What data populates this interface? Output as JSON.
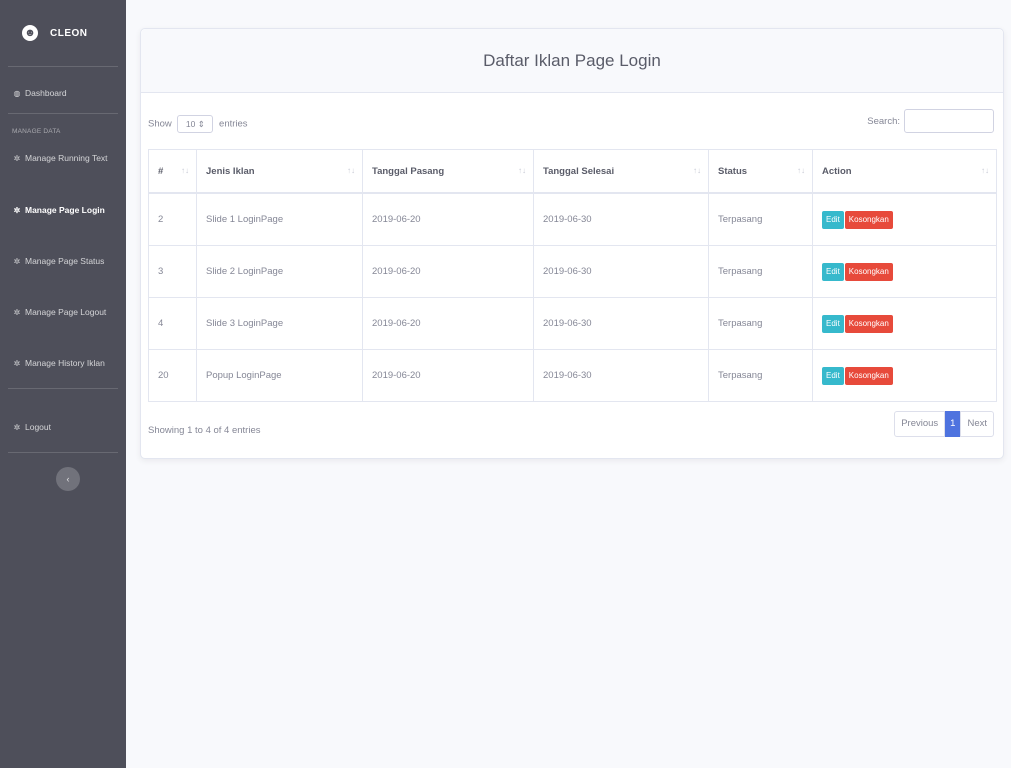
{
  "sidebar": {
    "brand": "CLEON",
    "brand_logo": "cleon-logo-icon",
    "dashboard": "Dashboard",
    "section_heading": "MANAGE DATA",
    "items": [
      {
        "label": "Manage Running Text",
        "icon": "gear-icon"
      },
      {
        "label": "Manage Page Login",
        "icon": "gear-icon"
      },
      {
        "label": "Manage Page Status",
        "icon": "gear-icon"
      },
      {
        "label": "Manage Page Logout",
        "icon": "gear-icon"
      },
      {
        "label": "Manage History Iklan",
        "icon": "gear-icon"
      }
    ],
    "active_item": "Manage Page Login",
    "logout": "Logout",
    "toggle_glyph": "‹"
  },
  "card": {
    "title": "Daftar Iklan Page Login"
  },
  "controls": {
    "show_label": "Show",
    "entries_value": "10",
    "entries_label": "entries",
    "search_label": "Search:",
    "search_value": ""
  },
  "table": {
    "headers": [
      "#",
      "Jenis Iklan",
      "Tanggal Pasang",
      "Tanggal Selesai",
      "Status",
      "Action"
    ],
    "rows": [
      {
        "no": "2",
        "jenis": "Slide 1 LoginPage",
        "pasang": "2019-06-20",
        "selesai": "2019-06-30",
        "status": "Terpasang"
      },
      {
        "no": "3",
        "jenis": "Slide 2 LoginPage",
        "pasang": "2019-06-20",
        "selesai": "2019-06-30",
        "status": "Terpasang"
      },
      {
        "no": "4",
        "jenis": "Slide 3 LoginPage",
        "pasang": "2019-06-20",
        "selesai": "2019-06-30",
        "status": "Terpasang"
      },
      {
        "no": "20",
        "jenis": "Popup LoginPage",
        "pasang": "2019-06-20",
        "selesai": "2019-06-30",
        "status": "Terpasang"
      }
    ],
    "edit_label": "Edit",
    "clear_label": "Kosongkan"
  },
  "footer": {
    "info": "Showing 1 to 4 of 4 entries",
    "previous": "Previous",
    "current_page": "1",
    "next": "Next"
  },
  "colors": {
    "sidebar_bg": "#4e4f5a",
    "edit_button": "#36b9cc",
    "clear_button": "#e74a3b",
    "active_page": "#4e73df"
  }
}
